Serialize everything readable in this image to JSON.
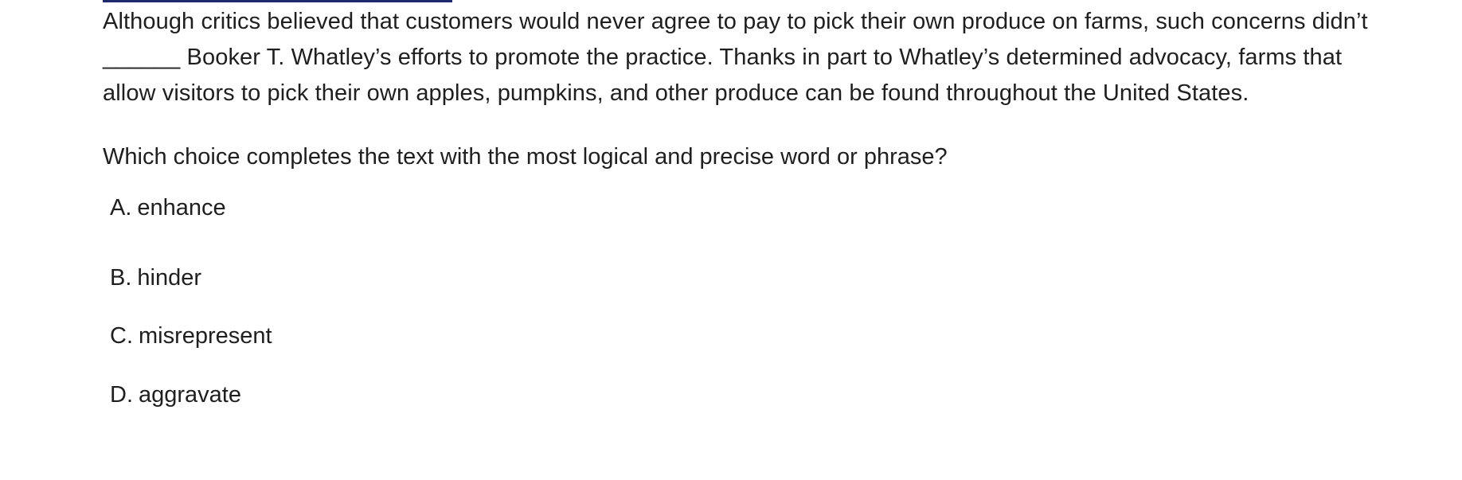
{
  "passage": {
    "sentence_1": "Although critics believed that customers would never agree to pay to pick their own produce on farms, such concerns didn’t",
    "blank": "______",
    "sentence_2": "Booker T. Whatley’s efforts to promote the practice. Thanks in part to Whatley’s determined advocacy, farms that allow visitors to pick their own apples, pumpkins, and other produce can be found throughout the United States."
  },
  "question": "Which choice completes the text with the most logical and precise word or phrase?",
  "choices": [
    {
      "letter": "A.",
      "text": "enhance"
    },
    {
      "letter": "B.",
      "text": "hinder"
    },
    {
      "letter": "C.",
      "text": "misrepresent"
    },
    {
      "letter": "D.",
      "text": "aggravate"
    }
  ],
  "colors": {
    "text": "#1f1f1f",
    "top_rule": "#1e2a6b",
    "background": "#ffffff"
  }
}
